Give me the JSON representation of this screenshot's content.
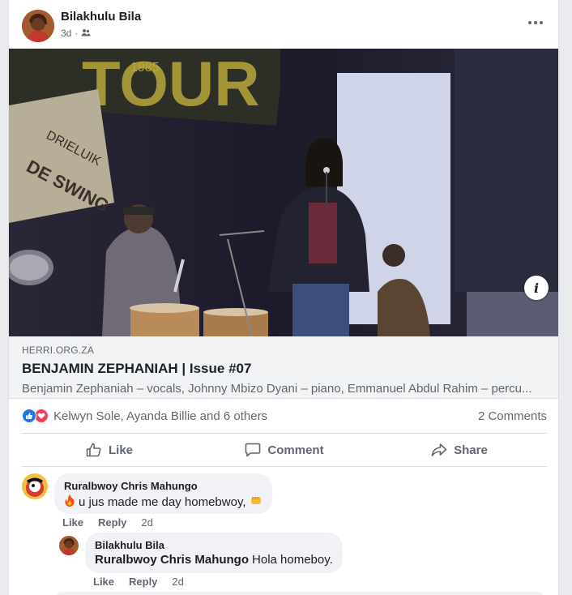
{
  "post": {
    "author": "Bilakhulu Bila",
    "time": "3d",
    "separator": "·",
    "audience_icon": "friends-icon"
  },
  "link": {
    "domain": "HERRI.ORG.ZA",
    "title": "BENJAMIN ZEPHANIAH | Issue #07",
    "description": "Benjamin Zephaniah – vocals, Johnny Mbizo Dyani – piano, Emmanuel Abdul Rahim – percu..."
  },
  "reactions": {
    "names": "Kelwyn Sole, Ayanda Billie and 6 others",
    "comments": "2 Comments"
  },
  "actions": {
    "like": "Like",
    "comment": "Comment",
    "share": "Share"
  },
  "comments": [
    {
      "author": "Ruralbwoy Chris Mahungo",
      "text": "u jus made me day homebwoy,",
      "like": "Like",
      "reply": "Reply",
      "time": "2d"
    },
    {
      "author": "Bilakhulu Bila",
      "mention": "Ruralbwoy Chris Mahungo",
      "text": "Hola homeboy.",
      "like": "Like",
      "reply": "Reply",
      "time": "2d"
    }
  ],
  "colors": {
    "like_blue": "#1877f2",
    "love_red": "#f33e58",
    "secondary_text": "#606770"
  }
}
